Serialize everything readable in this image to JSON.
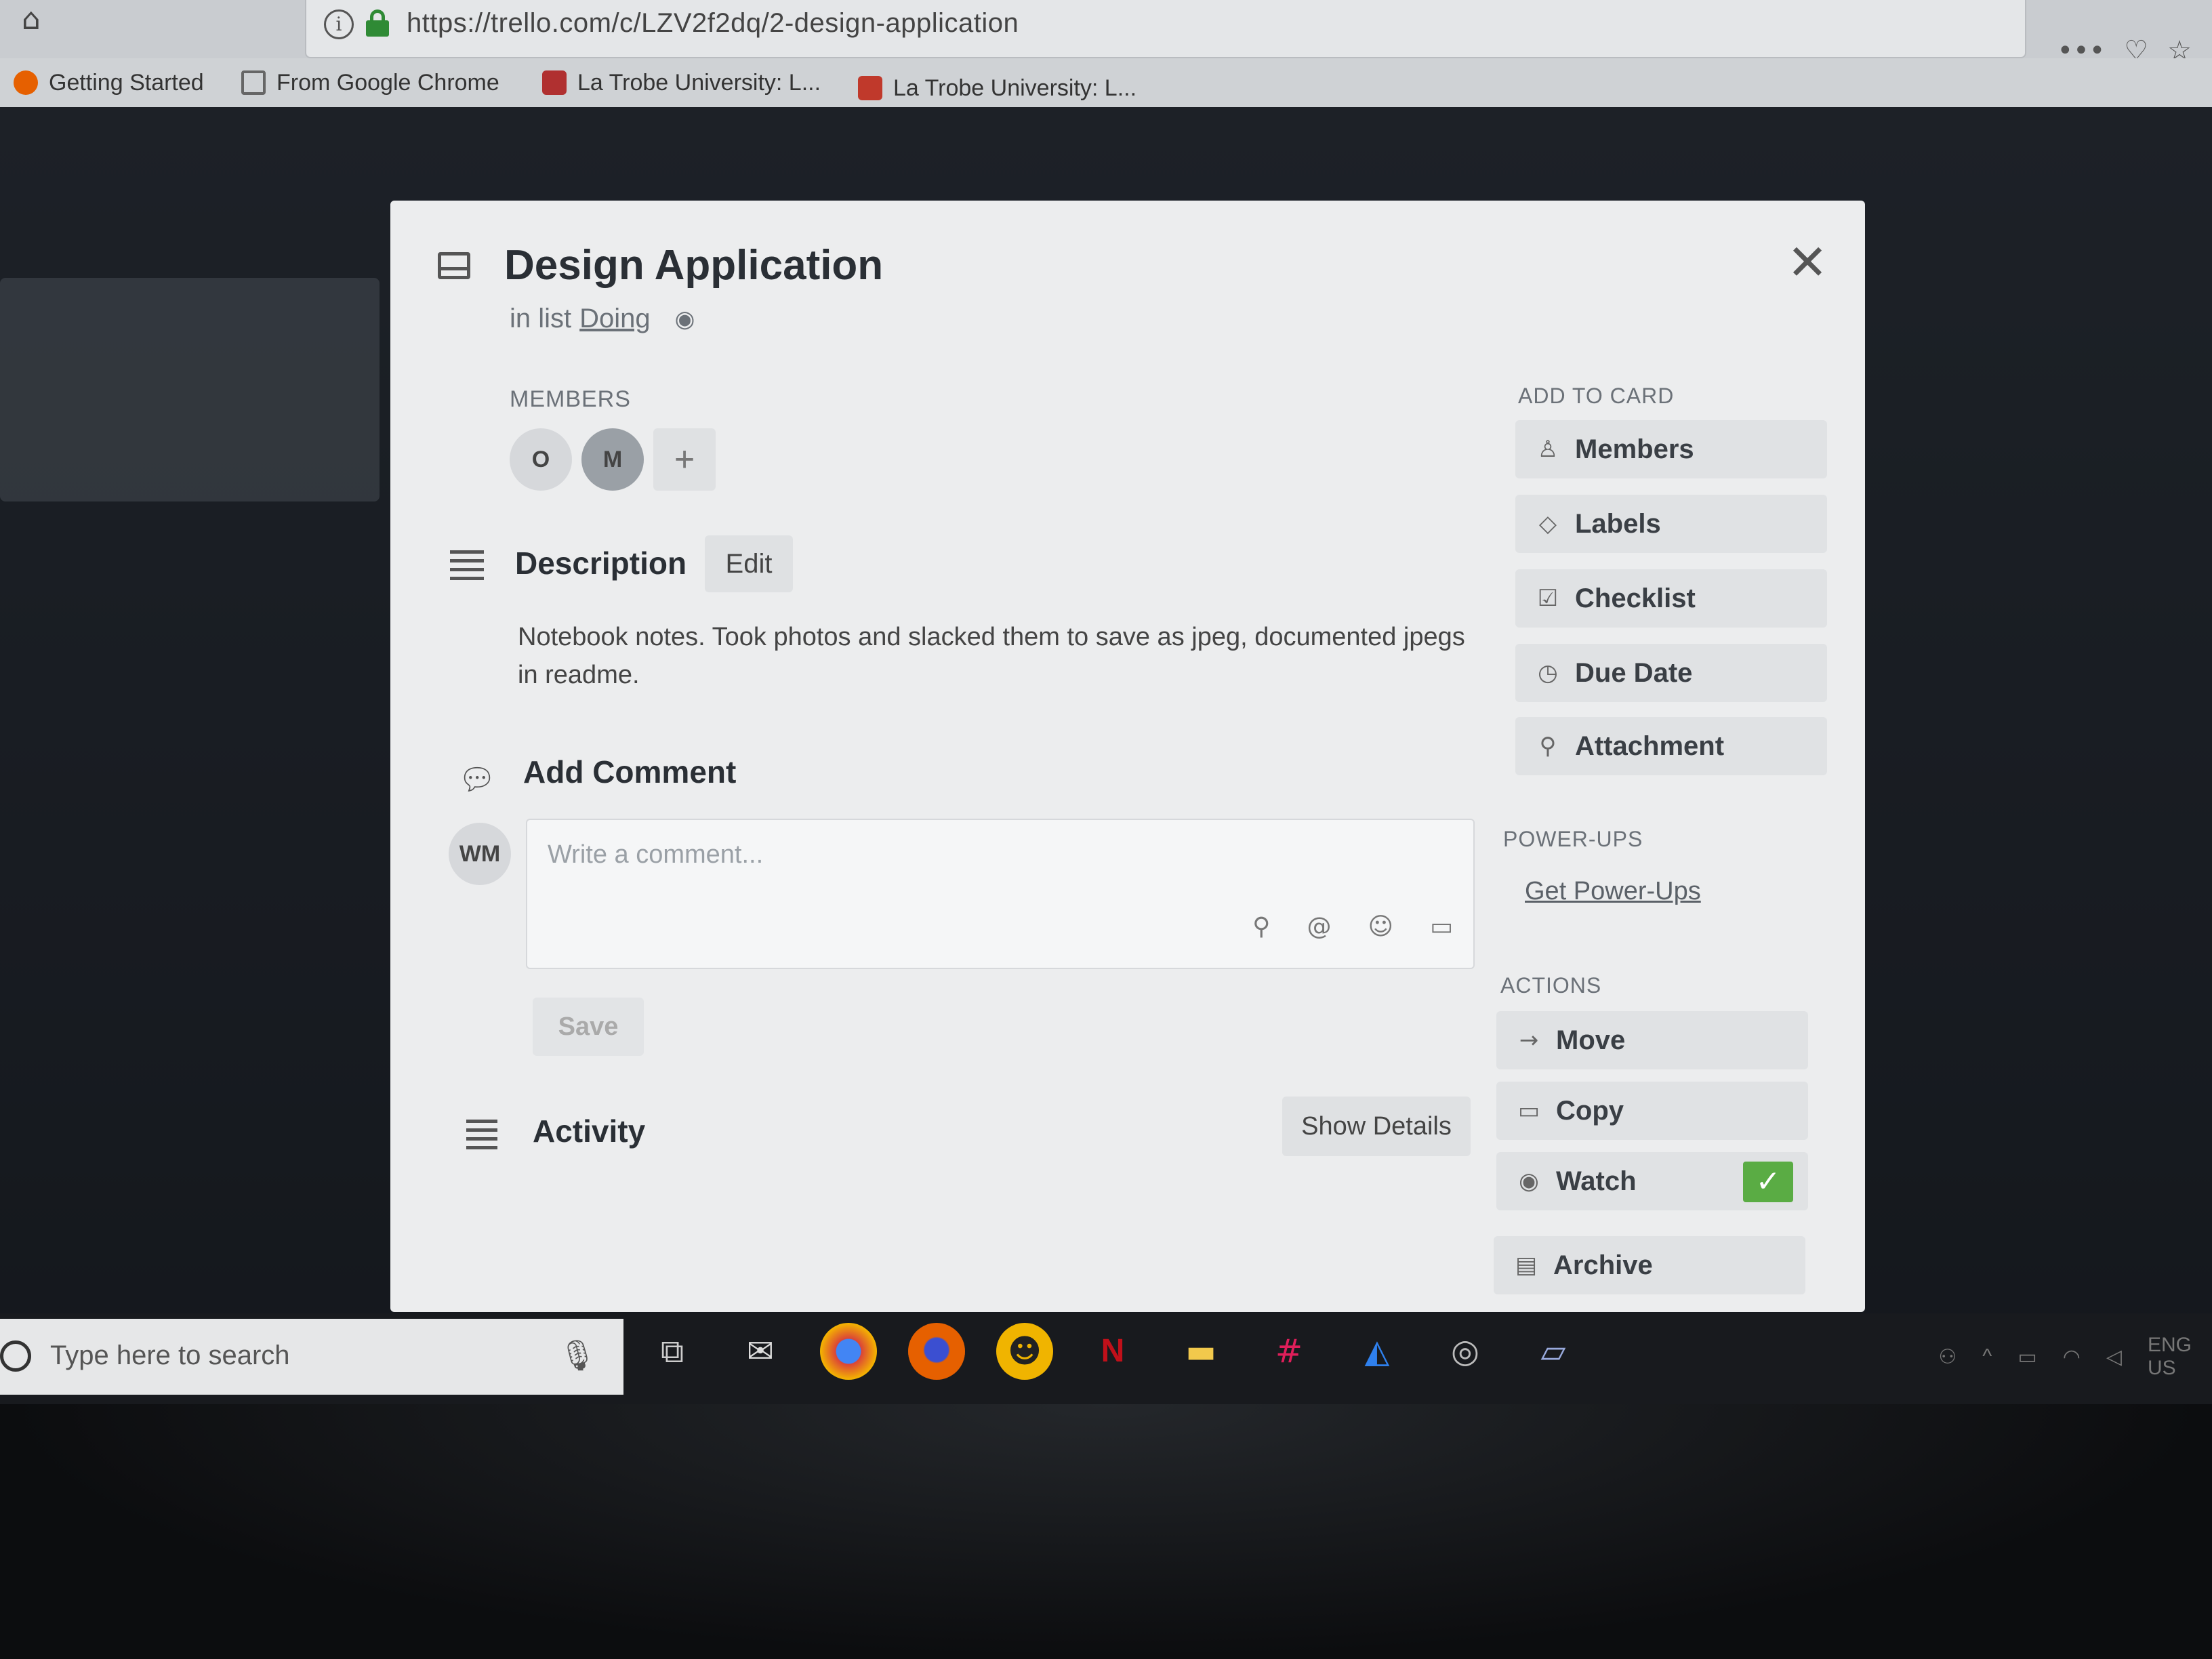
{
  "browser": {
    "url": "https://trello.com/c/LZV2f2dq/2-design-application",
    "url_actions": [
      "•••",
      "♡",
      "☆"
    ],
    "bookmarks": [
      {
        "label": "Getting Started",
        "icon": "firefox-icon",
        "color": "#e66000"
      },
      {
        "label": "From Google Chrome",
        "icon": "folder-icon",
        "color": "#777777"
      },
      {
        "label": "La Trobe University: L...",
        "icon": "latrobe-icon",
        "color": "#b03030"
      },
      {
        "label": "La Trobe University: L...",
        "icon": "latrobe-icon",
        "color": "#c0392b"
      }
    ]
  },
  "card": {
    "title": "Design Application",
    "in_list_prefix": "in list",
    "list_name": "Doing",
    "members_label": "MEMBERS",
    "members": [
      "O",
      "M"
    ],
    "add_member": "+",
    "description_title": "Description",
    "edit_label": "Edit",
    "description": "Notebook notes. Took photos and slacked them to save as jpeg, documented jpegs in readme.",
    "add_comment_title": "Add Comment",
    "commenter_initials": "WM",
    "comment_placeholder": "Write a comment...",
    "save_label": "Save",
    "activity_title": "Activity",
    "show_details_label": "Show Details"
  },
  "sidebar": {
    "add_to_card_heading": "ADD TO CARD",
    "add_to_card": [
      {
        "label": "Members",
        "icon": "person-icon"
      },
      {
        "label": "Labels",
        "icon": "tag-icon"
      },
      {
        "label": "Checklist",
        "icon": "checkbox-icon"
      },
      {
        "label": "Due Date",
        "icon": "clock-icon"
      },
      {
        "label": "Attachment",
        "icon": "paperclip-icon"
      }
    ],
    "powerups_heading": "POWER-UPS",
    "powerups_link": "Get Power-Ups",
    "actions_heading": "ACTIONS",
    "actions": [
      {
        "label": "Move",
        "icon": "arrow-right-icon"
      },
      {
        "label": "Copy",
        "icon": "copy-icon"
      },
      {
        "label": "Watch",
        "icon": "eye-icon",
        "checked": true
      },
      {
        "label": "Archive",
        "icon": "archive-icon"
      }
    ]
  },
  "taskbar": {
    "search_placeholder": "Type here to search",
    "tray_lang": "ENG",
    "tray_region": "US"
  },
  "colors": {
    "watch_check": "#5aac44",
    "lock_green": "#2f8a35"
  }
}
